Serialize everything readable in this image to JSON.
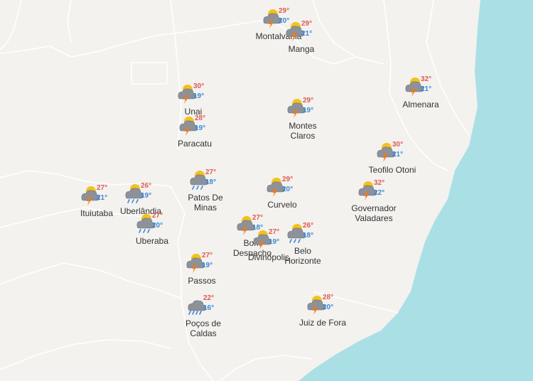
{
  "colors": {
    "land": "#f3f2ef",
    "sea": "#aadfe6",
    "border": "#ffffff",
    "max_temp": "#e05a52",
    "min_temp": "#3b87d8"
  },
  "cities": [
    {
      "key": "montalvania",
      "name": [
        "Montalvânia",
        ""
      ],
      "max": "29°",
      "min": "20°",
      "icon": "sun-cloud-storm-icon"
    },
    {
      "key": "manga",
      "name": [
        "Manga",
        ""
      ],
      "max": "29°",
      "min": "21°",
      "icon": "sun-cloud-storm-icon"
    },
    {
      "key": "unai",
      "name": [
        "Unai",
        ""
      ],
      "max": "30°",
      "min": "19°",
      "icon": "sun-cloud-storm-icon"
    },
    {
      "key": "paracatu",
      "name": [
        "Paracatu",
        ""
      ],
      "max": "28°",
      "min": "19°",
      "icon": "sun-cloud-storm-icon"
    },
    {
      "key": "montes-claros",
      "name": [
        "Montes",
        "Claros"
      ],
      "max": "29°",
      "min": "19°",
      "icon": "sun-cloud-storm-icon"
    },
    {
      "key": "almenara",
      "name": [
        "Almenara",
        ""
      ],
      "max": "32°",
      "min": "21°",
      "icon": "sun-cloud-storm-icon"
    },
    {
      "key": "teofilo-otoni",
      "name": [
        "Teofilo Otoni",
        ""
      ],
      "max": "30°",
      "min": "21°",
      "icon": "sun-cloud-storm-icon"
    },
    {
      "key": "governador-valadares",
      "name": [
        "Governador",
        "Valadares"
      ],
      "max": "32°",
      "min": "22°",
      "icon": "sun-cloud-storm-icon"
    },
    {
      "key": "ituiutaba",
      "name": [
        "Ituiutaba",
        ""
      ],
      "max": "27°",
      "min": "21°",
      "icon": "sun-cloud-storm-icon"
    },
    {
      "key": "uberlandia",
      "name": [
        "Uberlândia",
        ""
      ],
      "max": "26°",
      "min": "19°",
      "icon": "sun-cloud-rain-icon"
    },
    {
      "key": "patos-de-minas",
      "name": [
        "Patos De",
        "Minas"
      ],
      "max": "27°",
      "min": "18°",
      "icon": "sun-cloud-rain-icon"
    },
    {
      "key": "curvelo",
      "name": [
        "Curvelo",
        ""
      ],
      "max": "29°",
      "min": "20°",
      "icon": "sun-cloud-storm-icon"
    },
    {
      "key": "uberaba",
      "name": [
        "Uberaba",
        ""
      ],
      "max": "27°",
      "min": "20°",
      "icon": "sun-cloud-rain-icon"
    },
    {
      "key": "bom-despacho",
      "name": [
        "Bom",
        "Despacho"
      ],
      "max": "27°",
      "min": "18°",
      "icon": "sun-cloud-storm-icon"
    },
    {
      "key": "divinopolis",
      "name": [
        "Divinópolis",
        ""
      ],
      "max": "27°",
      "min": "19°",
      "icon": "sun-cloud-storm-icon"
    },
    {
      "key": "belo-horizonte",
      "name": [
        "Belo",
        "Horizonte"
      ],
      "max": "26°",
      "min": "18°",
      "icon": "sun-cloud-rain-icon"
    },
    {
      "key": "passos",
      "name": [
        "Passos",
        ""
      ],
      "max": "27°",
      "min": "19°",
      "icon": "sun-cloud-storm-icon"
    },
    {
      "key": "pocos-de-caldas",
      "name": [
        "Poços de",
        "Caldas"
      ],
      "max": "22°",
      "min": "16°",
      "icon": "cloud-rain-icon"
    },
    {
      "key": "juiz-de-fora",
      "name": [
        "Juiz de Fora",
        ""
      ],
      "max": "28°",
      "min": "20°",
      "icon": "sun-cloud-storm-icon"
    }
  ]
}
